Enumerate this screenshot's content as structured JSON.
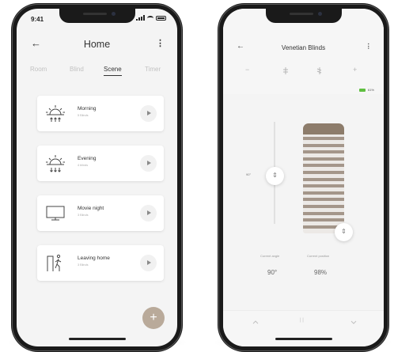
{
  "left_phone": {
    "status_time": "9:41",
    "header": {
      "title": "Home"
    },
    "tabs": [
      {
        "label": "Room"
      },
      {
        "label": "Blind"
      },
      {
        "label": "Scene"
      },
      {
        "label": "Timer"
      }
    ],
    "active_tab": "Scene",
    "scenes": [
      {
        "name": "Morning",
        "sub": "5 Blinds",
        "icon": "sunrise-icon"
      },
      {
        "name": "Evening",
        "sub": "4 blinds",
        "icon": "sunset-icon"
      },
      {
        "name": "Movie night",
        "sub": "3 Blinds",
        "icon": "tv-icon"
      },
      {
        "name": "Leaving home",
        "sub": "3 Blinds",
        "icon": "leaving-home-icon"
      }
    ],
    "fab_label": "+"
  },
  "right_phone": {
    "header": {
      "title": "Venetian Blinds"
    },
    "controls": {
      "minus": "−",
      "plus": "+"
    },
    "battery": "61%",
    "angle_value": "90°",
    "current_angle_label": "Current angle",
    "current_position_label": "Current position",
    "current_angle": "90°",
    "current_position": "98%",
    "position_fraction": 0.98,
    "bottom_controls": {
      "pause": "| |"
    }
  },
  "colors": {
    "accent": "#b9aa9a",
    "blind_head": "#8d7c6b",
    "blind_slat": "#a4968a",
    "battery": "#5fbf40"
  }
}
